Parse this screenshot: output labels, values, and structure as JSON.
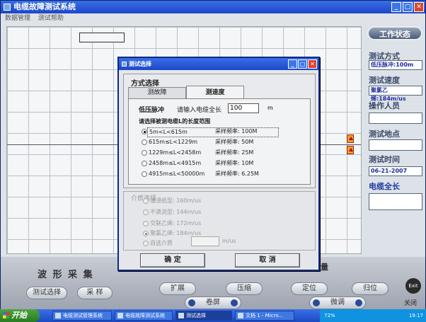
{
  "window": {
    "title": "电缆故障测试系统",
    "menu": [
      "数据管理",
      "测试帮助"
    ],
    "buttons": {
      "minimize": "_",
      "maximize": "□",
      "close": "✕"
    }
  },
  "right_panel": {
    "status": "工作状态",
    "test_mode_label": "测试方式",
    "test_mode_value": "低压脉冲:100m",
    "test_speed_label": "测试速度",
    "test_speed_value": "聚氯乙烯:184m/us",
    "operator_label": "操作人员",
    "location_label": "测试地点",
    "time_label": "测试时间",
    "time_value": "06-21-2007",
    "cable_length_label": "电缆全长"
  },
  "bottom": {
    "waveform_label": "波 形 采 集",
    "test_select": "测试选择",
    "sample": "采 样",
    "expand": "扩展",
    "compress": "压缩",
    "locate": "定位",
    "reset": "归位",
    "scroll": "卷屏",
    "fine_tune": "微调",
    "exit": "Exit",
    "close": "关闭",
    "partial_label": "量"
  },
  "dialog": {
    "title": "测试选择",
    "group_title": "方式选择",
    "tabs": [
      "测故障",
      "测速度"
    ],
    "pulse_label": "低压脉冲",
    "pulse_hint": "请输入电缆全长",
    "length_value": "100",
    "length_unit": "m",
    "range_title": "请选择被测电缆L的长度范围",
    "ranges": [
      {
        "range": "5m<L<615m",
        "freq": "采样频率: 100M"
      },
      {
        "range": "615m≤L<1229m",
        "freq": "采样频率: 50M"
      },
      {
        "range": "1229m≤L<2458m",
        "freq": "采样频率: 25M"
      },
      {
        "range": "2458m≤L<4915m",
        "freq": "采样频率: 10M"
      },
      {
        "range": "4915m≤L<50000m",
        "freq": "采样频率: 6.25M"
      }
    ],
    "medium_title": "介质选择",
    "media": [
      "油浸纸型: 160m/us",
      "不滴流型: 144m/us",
      "交联乙烯: 172m/us",
      "聚氯乙烯: 184m/us",
      "自选介质"
    ],
    "custom_unit": "m/us",
    "ok": "确 定",
    "cancel": "取 消"
  },
  "taskbar": {
    "start": "开始",
    "tasks": [
      "电缆测试管理系统",
      "电缆故障测试系统",
      "测试选择",
      "文档 1 - Micro..."
    ],
    "tray_text": "72%",
    "clock": "19:17"
  }
}
